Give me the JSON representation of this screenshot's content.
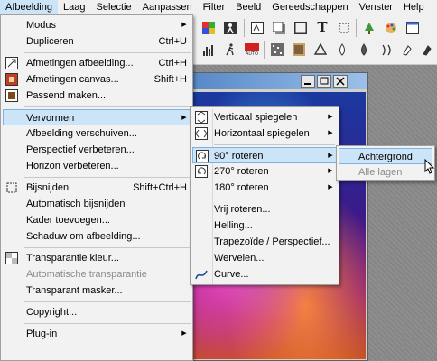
{
  "menubar": {
    "items": [
      "Afbeelding",
      "Laag",
      "Selectie",
      "Aanpassen",
      "Filter",
      "Beeld",
      "Gereedschappen",
      "Venster",
      "Help"
    ]
  },
  "toolbar": {
    "icons": [
      "color-swatch-icon",
      "figure-icon",
      "contrast-icon",
      "shadow-icon",
      "text-icon",
      "frame-icon",
      "cut-icon",
      "tree-icon",
      "palette-icon",
      "window-icon",
      "histogram-icon",
      "noise-icon",
      "run-icon",
      "auto-icon",
      "sharpen-icon",
      "blur-icon",
      "heal-icon",
      "drop-icon",
      "water-icon",
      "smudge-icon",
      "burn-icon",
      "dodge-icon"
    ]
  },
  "image_menu": {
    "items": [
      {
        "label": "Modus",
        "submenu": true,
        "icon": ""
      },
      {
        "label": "Dupliceren",
        "shortcut": "Ctrl+U",
        "icon": ""
      },
      {
        "label": "Afmetingen afbeelding...",
        "shortcut": "Ctrl+H",
        "icon": "resize-image-icon"
      },
      {
        "label": "Afmetingen canvas...",
        "shortcut": "Shift+H",
        "icon": "resize-canvas-icon"
      },
      {
        "label": "Passend maken...",
        "icon": "fit-icon"
      },
      {
        "label": "Vervormen",
        "submenu": true,
        "highlighted": true
      },
      {
        "label": "Afbeelding verschuiven..."
      },
      {
        "label": "Perspectief verbeteren..."
      },
      {
        "label": "Horizon verbeteren..."
      },
      {
        "label": "Bijsnijden",
        "shortcut": "Shift+Ctrl+H",
        "icon": "crop-icon"
      },
      {
        "label": "Automatisch bijsnijden"
      },
      {
        "label": "Kader toevoegen..."
      },
      {
        "label": "Schaduw om afbeelding..."
      },
      {
        "label": "Transparantie kleur...",
        "icon": "transparency-color-icon"
      },
      {
        "label": "Automatische transparantie",
        "disabled": true
      },
      {
        "label": "Transparant masker..."
      },
      {
        "label": "Copyright..."
      },
      {
        "label": "Plug-in",
        "submenu": true
      }
    ]
  },
  "transform_menu": {
    "items": [
      {
        "label": "Verticaal spiegelen",
        "submenu": true,
        "icon": "flip-vertical-icon"
      },
      {
        "label": "Horizontaal spiegelen",
        "submenu": true,
        "icon": "flip-horizontal-icon"
      },
      {
        "label": "90° roteren",
        "submenu": true,
        "highlighted": true,
        "icon": "rotate-90-icon"
      },
      {
        "label": "270° roteren",
        "submenu": true,
        "icon": "rotate-270-icon"
      },
      {
        "label": "180° roteren",
        "submenu": true
      },
      {
        "label": "Vrij roteren..."
      },
      {
        "label": "Helling..."
      },
      {
        "label": "Trapezoïde / Perspectief..."
      },
      {
        "label": "Wervelen..."
      },
      {
        "label": "Curve...",
        "icon": "curve-icon"
      }
    ]
  },
  "rotate_menu": {
    "items": [
      {
        "label": "Achtergrond",
        "highlighted": true
      },
      {
        "label": "Alle lagen",
        "disabled": true
      }
    ]
  },
  "colors": {
    "highlight": "#cce4f7",
    "highlight_border": "#7fb2de",
    "menu_bg": "#f2f2f2",
    "disabled_text": "#8c8c8c"
  }
}
